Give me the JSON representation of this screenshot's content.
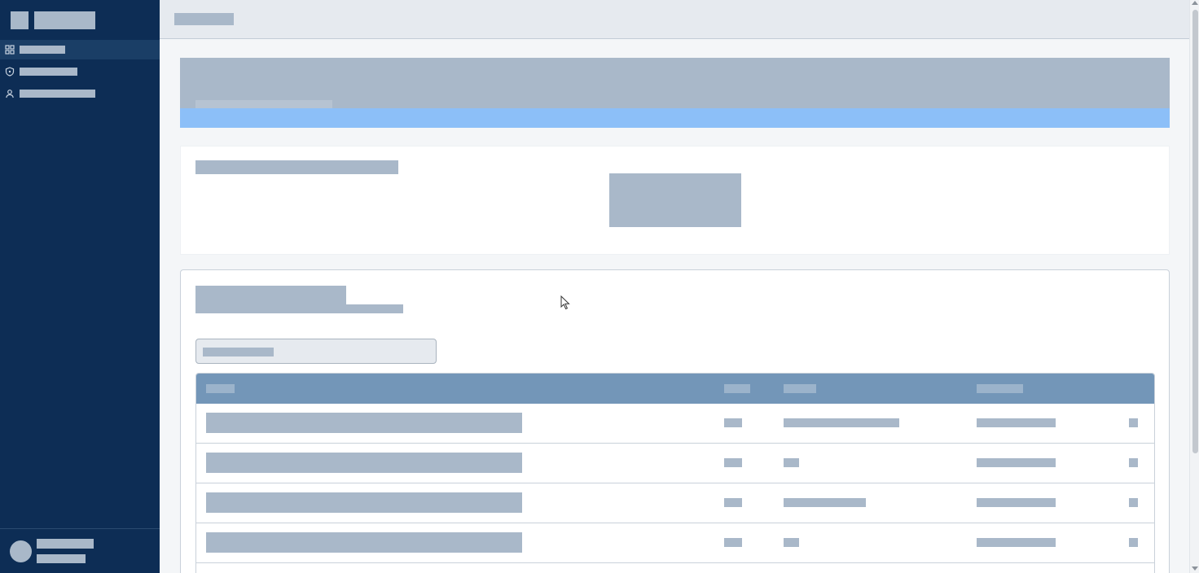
{
  "sidebar": {
    "brand": {},
    "items": [
      {
        "icon": "grid-icon",
        "active": true
      },
      {
        "icon": "shield-icon",
        "active": false
      },
      {
        "icon": "user-icon",
        "active": false
      }
    ],
    "user": {}
  },
  "topbar": {},
  "banner": {},
  "summary_card": {},
  "list_card": {
    "search": {
      "placeholder": ""
    },
    "table": {
      "columns": 5,
      "rows": 4
    }
  },
  "colors": {
    "sidebar_bg": "#0d2d55",
    "sidebar_active": "#1a3e66",
    "banner_bg": "#a9b8c9",
    "banner_accent": "#8cbff8",
    "table_header": "#7396b8",
    "placeholder": "#a9b8c9"
  }
}
